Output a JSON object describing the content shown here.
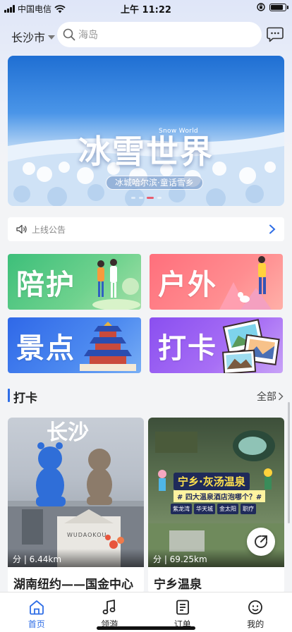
{
  "status_bar": {
    "carrier": "中国电信",
    "time": "上午 11:22",
    "battery_level": 0.85
  },
  "header": {
    "city": "长沙市",
    "search_placeholder": "海岛"
  },
  "banner": {
    "title": "冰雪世界",
    "title_en": "Snow World",
    "subtitle": "冰城哈尔滨·童话雪乡",
    "active_dot": 2,
    "dot_count": 4
  },
  "notice": {
    "text": "上线公告"
  },
  "categories": [
    {
      "label": "陪护"
    },
    {
      "label": "户外"
    },
    {
      "label": "景点"
    },
    {
      "label": "打卡"
    }
  ],
  "section": {
    "title": "打卡",
    "more": "全部"
  },
  "cards": [
    {
      "name": "湖南纽约——国金中心",
      "distance": "分 | 6.44km",
      "overlay_text": "长沙",
      "brand": "WUDAOKOU"
    },
    {
      "name": "宁乡温泉",
      "distance": "分 | 69.25km",
      "overlay_title": "宁乡·灰汤温泉",
      "overlay_sub": "# 四大温泉酒店泡哪个？#",
      "tags": [
        "紫龙湾",
        "华天城",
        "金太阳",
        "职疗"
      ]
    }
  ],
  "tabs": [
    {
      "label": "首页",
      "icon": "home-icon",
      "active": true
    },
    {
      "label": "领游",
      "icon": "music-note-icon",
      "active": false
    },
    {
      "label": "订单",
      "icon": "order-icon",
      "active": false
    },
    {
      "label": "我的",
      "icon": "user-face-icon",
      "active": false
    }
  ],
  "colors": {
    "accent": "#2f6ee6",
    "background": "#f3f4f6"
  }
}
